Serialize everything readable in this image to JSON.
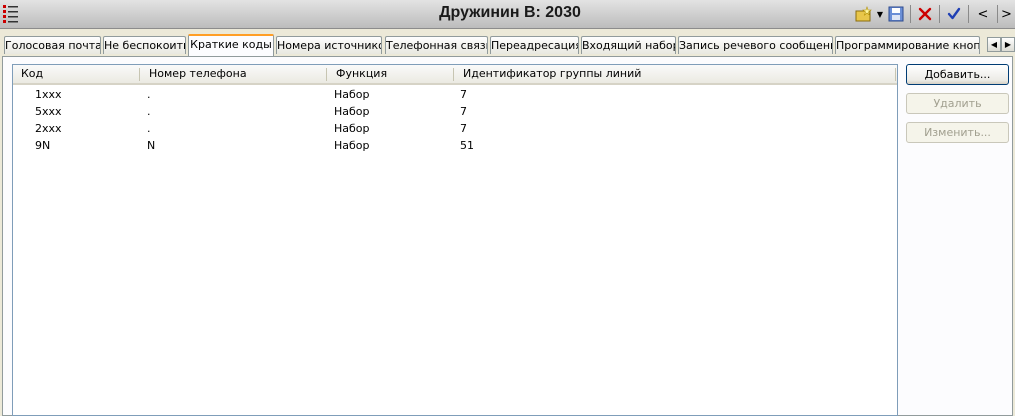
{
  "window": {
    "title": "Дружинин В: 2030"
  },
  "toolbar": {
    "prev_label": "<",
    "next_label": ">"
  },
  "tabs": [
    {
      "label": "Голосовая почта",
      "active": false
    },
    {
      "label": "Не беспокоить",
      "active": false
    },
    {
      "label": "Краткие коды",
      "active": true
    },
    {
      "label": "Номера источников",
      "active": false
    },
    {
      "label": "Телефонная связь",
      "active": false
    },
    {
      "label": "Переадресация",
      "active": false
    },
    {
      "label": "Входящий набор",
      "active": false
    },
    {
      "label": "Запись речевого сообщения",
      "active": false
    },
    {
      "label": "Программирование кнопок",
      "active": false
    }
  ],
  "table": {
    "columns": [
      "Код",
      "Номер телефона",
      "Функция",
      "Идентификатор группы линий"
    ],
    "rows": [
      [
        "1xxx",
        ".",
        "Набор",
        "7"
      ],
      [
        "5xxx",
        ".",
        "Набор",
        "7"
      ],
      [
        "2xxx",
        ".",
        "Набор",
        "7"
      ],
      [
        "9N",
        "N",
        "Набор",
        "51"
      ]
    ]
  },
  "buttons": {
    "add": "Добавить...",
    "delete": "Удалить",
    "edit": "Изменить..."
  },
  "colors": {
    "active_tab_accent": "#ff9e25",
    "close_red": "#cc0000",
    "check_blue": "#1f3fb4"
  }
}
